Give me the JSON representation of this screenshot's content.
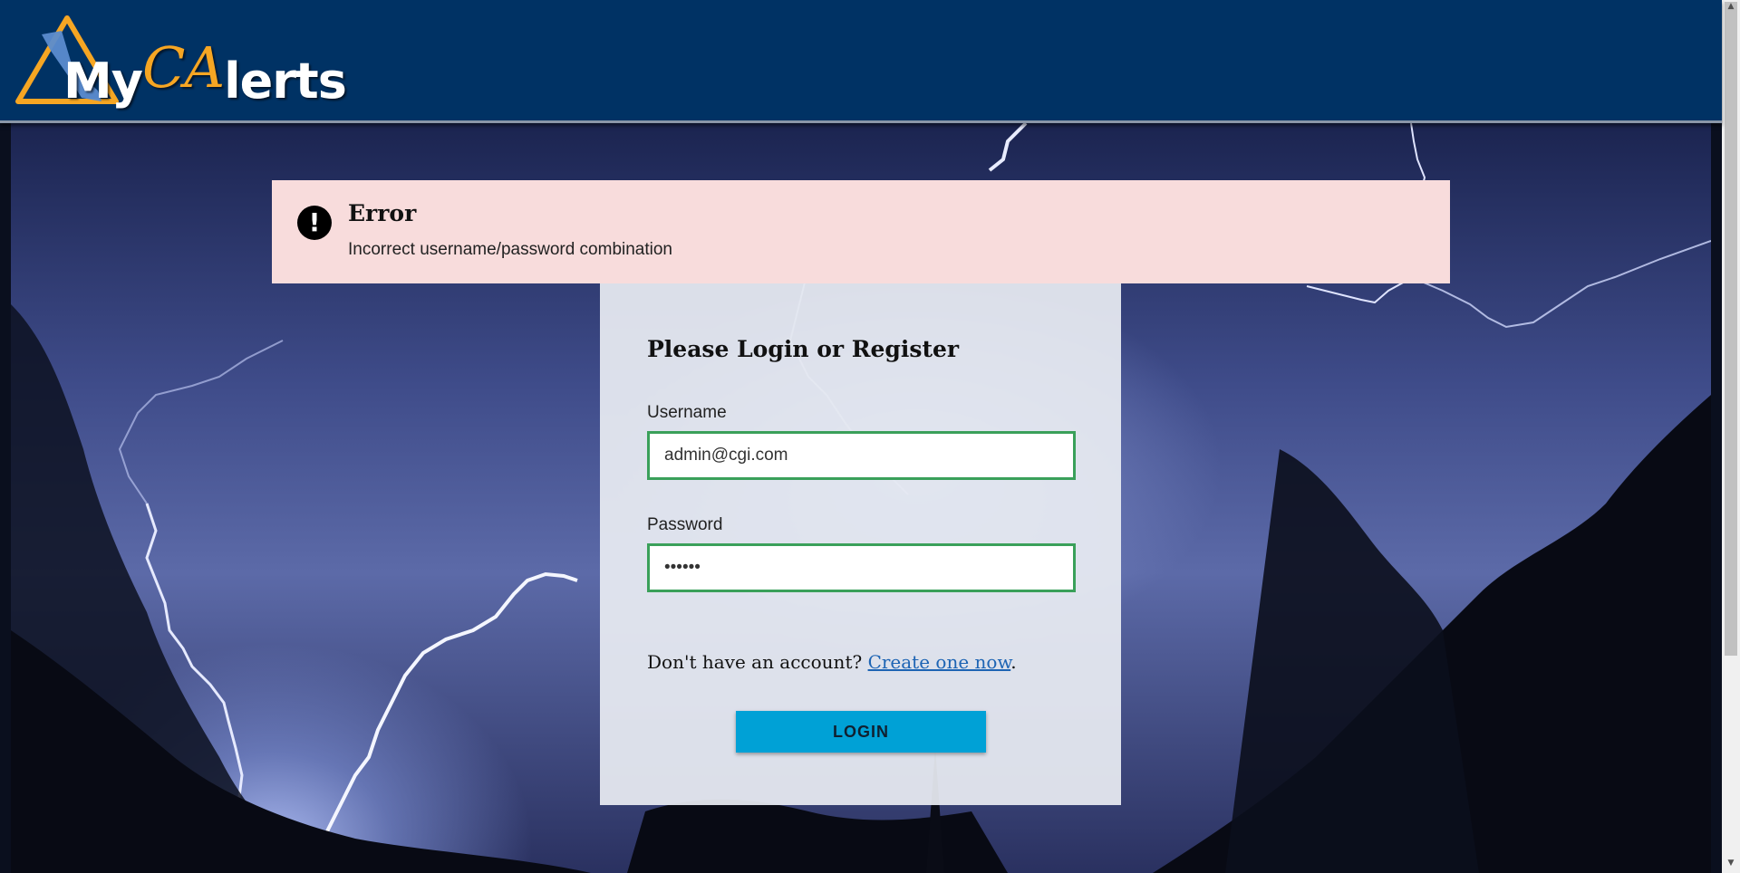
{
  "header": {
    "logo": {
      "text_prefix": "My",
      "text_ca": "CA",
      "text_suffix": "lerts",
      "accent": "#f6a623"
    },
    "background_color": "#003264"
  },
  "error": {
    "icon": "exclamation-icon",
    "title": "Error",
    "message": "Incorrect username/password combination",
    "background": "#f8dcdc"
  },
  "login": {
    "title": "Please Login or Register",
    "username_label": "Username",
    "username_value": "admin@cgi.com",
    "password_label": "Password",
    "password_value": "••••••",
    "register_prompt": "Don't have an account?",
    "register_link": "Create one now",
    "register_suffix": ".",
    "button_label": "LOGIN",
    "button_color": "#00a1d6",
    "field_border_color": "#3aa05a"
  }
}
